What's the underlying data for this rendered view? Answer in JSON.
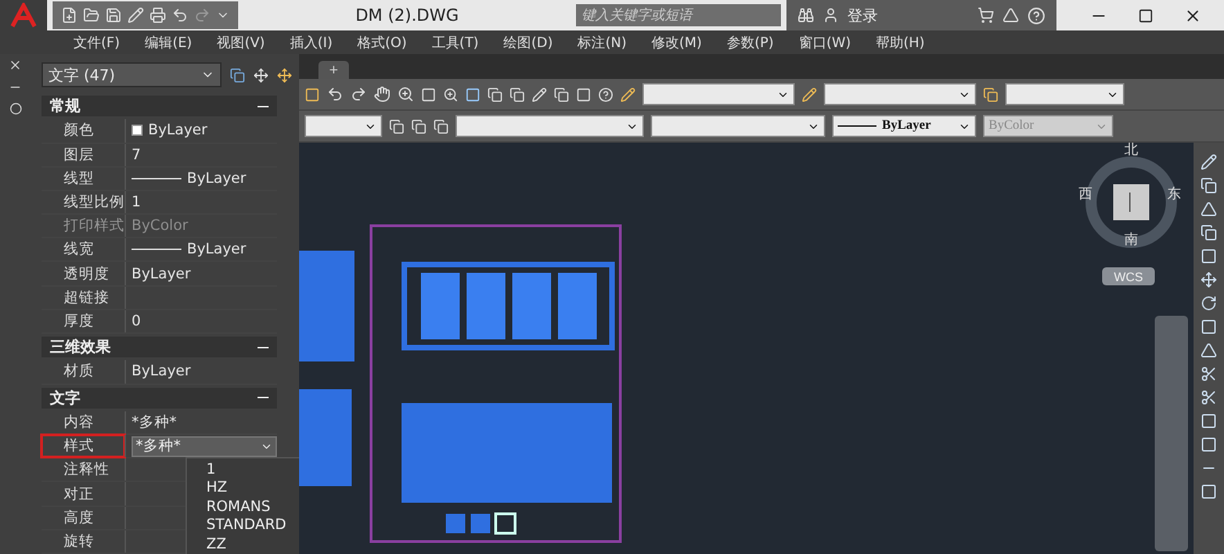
{
  "title_bar": {
    "title": "DM (2).DWG",
    "search": {
      "placeholder": "键入关键字或短语"
    },
    "sign_in": "登录"
  },
  "menu_bar": [
    "文件(F)",
    "编辑(E)",
    "视图(V)",
    "插入(I)",
    "格式(O)",
    "工具(T)",
    "绘图(D)",
    "标注(N)",
    "修改(M)",
    "参数(P)",
    "窗口(W)",
    "帮助(H)"
  ],
  "drawing_tabs": {
    "add": "+"
  },
  "toolbar_row_2": [
    {
      "kind": "plain",
      "disabled": false
    },
    {
      "kind": "plain",
      "disabled": false
    },
    {
      "kind": "plain",
      "disabled": false
    },
    {
      "kind": "line",
      "value": "ByLayer",
      "disabled": false
    },
    {
      "kind": "plain",
      "value": "ByColor",
      "disabled": true
    }
  ],
  "properties": {
    "selector": "文字 (47)",
    "sections": [
      {
        "title": "常规",
        "expanded": true,
        "rows": [
          {
            "label": "颜色",
            "value": "ByLayer",
            "kind": "swatch",
            "disabled": false,
            "highlighted": false
          },
          {
            "label": "图层",
            "value": "7",
            "kind": "text",
            "disabled": false,
            "highlighted": false
          },
          {
            "label": "线型",
            "value": "ByLayer",
            "kind": "line",
            "disabled": false,
            "highlighted": false
          },
          {
            "label": "线型比例",
            "value": "1",
            "kind": "text",
            "disabled": false,
            "highlighted": false
          },
          {
            "label": "打印样式",
            "value": "ByColor",
            "kind": "text",
            "disabled": true,
            "highlighted": false
          },
          {
            "label": "线宽",
            "value": "ByLayer",
            "kind": "line",
            "disabled": false,
            "highlighted": false
          },
          {
            "label": "透明度",
            "value": "ByLayer",
            "kind": "text",
            "disabled": false,
            "highlighted": false
          },
          {
            "label": "超链接",
            "kind": "text",
            "disabled": false,
            "highlighted": false
          },
          {
            "label": "厚度",
            "value": "0",
            "kind": "text",
            "disabled": false,
            "highlighted": false
          }
        ]
      },
      {
        "title": "三维效果",
        "expanded": true,
        "rows": [
          {
            "label": "材质",
            "value": "ByLayer",
            "kind": "text",
            "disabled": false,
            "highlighted": false
          }
        ]
      },
      {
        "title": "文字",
        "expanded": true,
        "rows": [
          {
            "label": "内容",
            "value": "*多种*",
            "kind": "text",
            "disabled": false,
            "highlighted": false
          },
          {
            "label": "样式",
            "value": "*多种*",
            "kind": "combo",
            "disabled": false,
            "highlighted": true
          },
          {
            "label": "注释性",
            "kind": "text",
            "disabled": false,
            "highlighted": false
          },
          {
            "label": "对正",
            "kind": "text",
            "disabled": false,
            "highlighted": false
          },
          {
            "label": "高度",
            "kind": "text",
            "disabled": false,
            "highlighted": false
          },
          {
            "label": "旋转",
            "kind": "text",
            "disabled": false,
            "highlighted": false
          }
        ]
      }
    ],
    "style_options": [
      "1",
      "HZ",
      "ROMANS",
      "STANDARD",
      "ZZ"
    ]
  },
  "view_cube": {
    "north": "北",
    "south": "南",
    "west": "西",
    "east": "东",
    "ucs": "WCS"
  }
}
